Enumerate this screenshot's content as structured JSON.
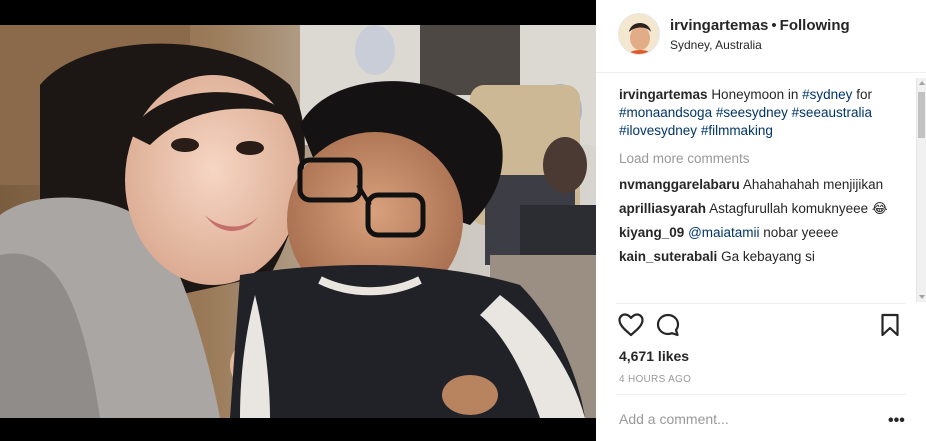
{
  "post": {
    "username": "irvingartemas",
    "separator": "•",
    "follow_status": "Following",
    "location": "Sydney, Australia",
    "caption": {
      "user": "irvingartemas",
      "text_before": "Honeymoon in",
      "hashtags": [
        "#sydney",
        "#monaandsoga",
        "#seesydney",
        "#seeaustralia",
        "#ilovesydney",
        "#filmmaking"
      ],
      "word_for": "for"
    },
    "load_more_label": "Load more comments",
    "comments": [
      {
        "user": "nvmanggarelabaru",
        "text": "Ahahahahah menjijikan"
      },
      {
        "user": "aprilliasyarah",
        "text": "Astagfurullah komuknyeee 😂"
      },
      {
        "user": "kiyang_09",
        "mention": "@maiatamii",
        "text": "nobar yeeee"
      },
      {
        "user": "kain_suterabali",
        "text": "Ga kebayang si"
      }
    ],
    "likes": "4,671 likes",
    "timestamp": "4 HOURS AGO",
    "comment_placeholder": "Add a comment...",
    "more_label": "•••"
  },
  "icons": {
    "like": "heart-icon",
    "comment": "comment-bubble-icon",
    "save": "bookmark-icon",
    "more": "more-options-icon"
  },
  "colors": {
    "link": "#003569",
    "muted": "#999999",
    "text": "#262626",
    "border": "#efefef"
  }
}
